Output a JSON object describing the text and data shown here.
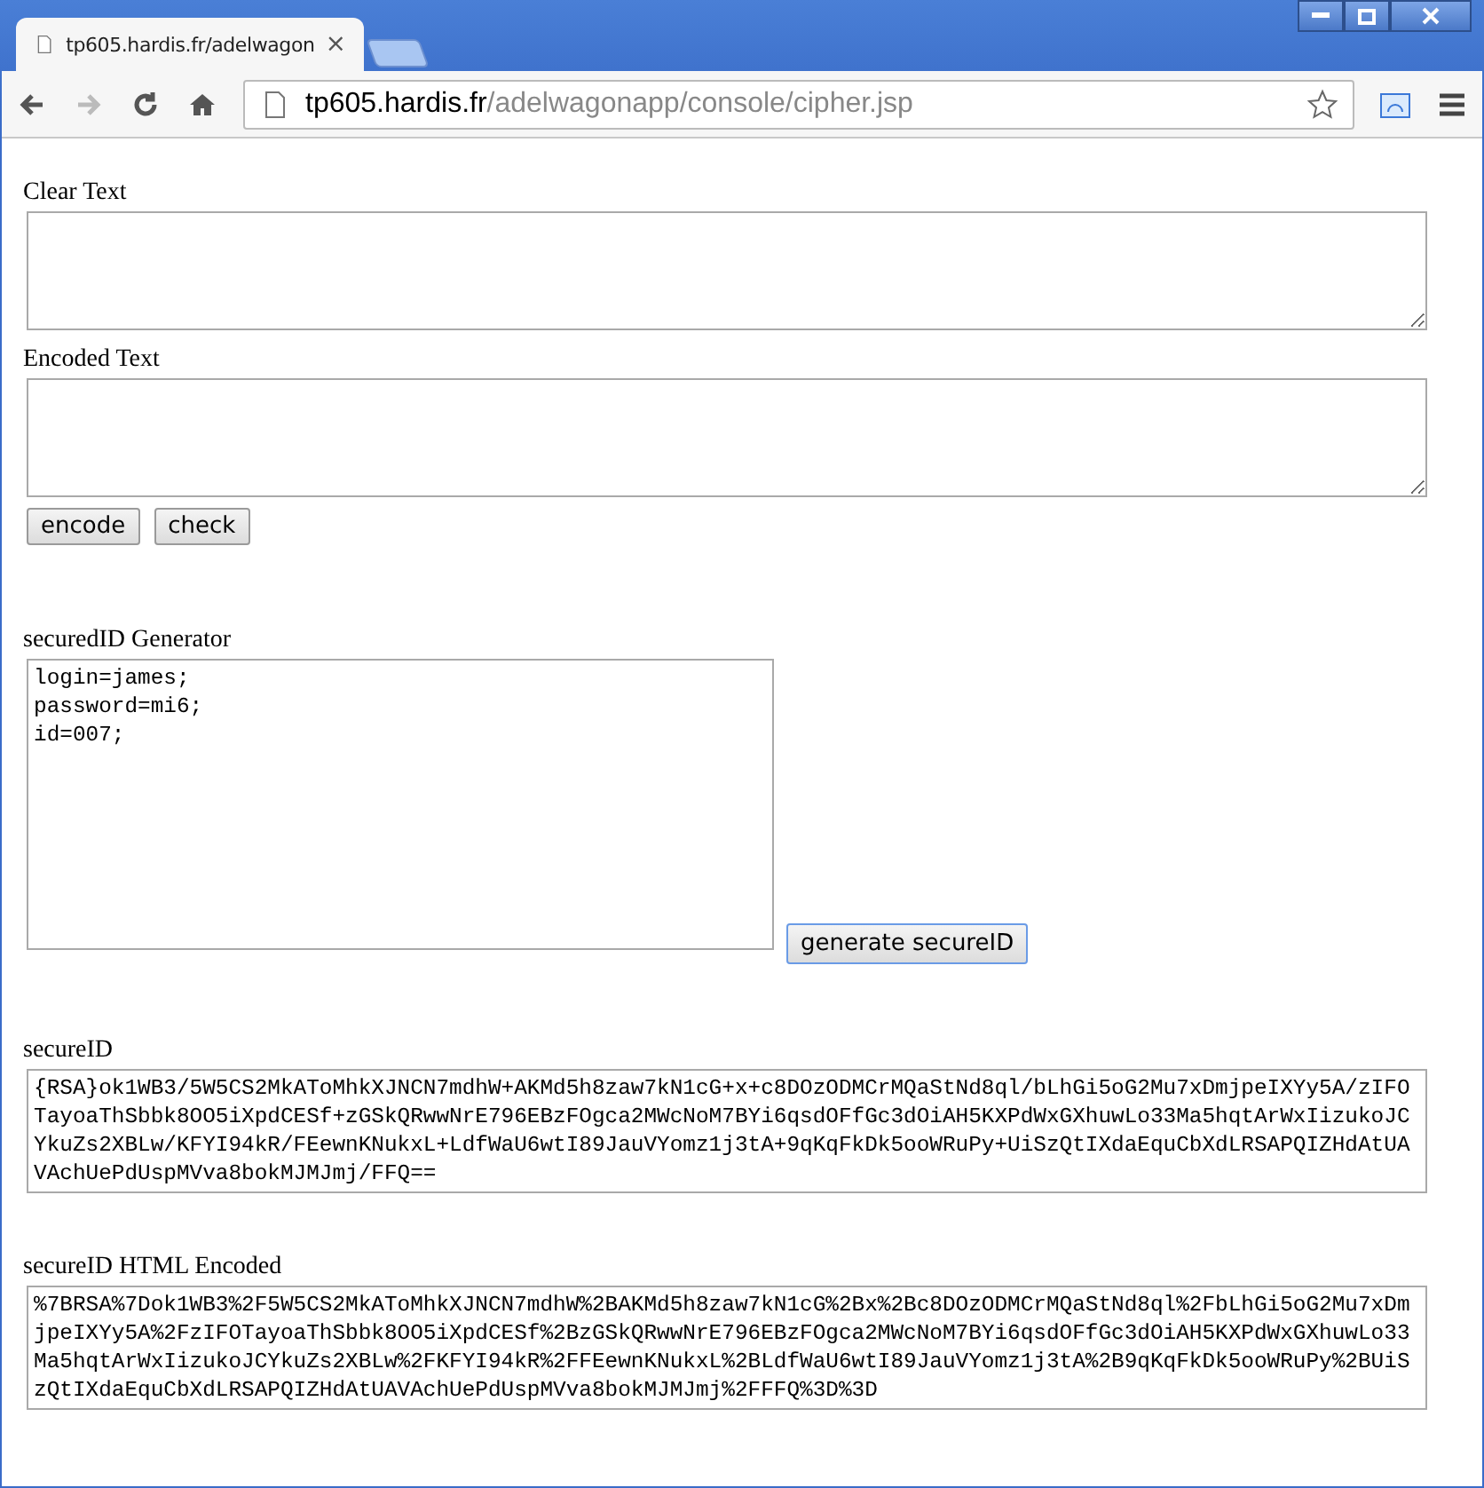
{
  "window": {
    "tab_title": "tp605.hardis.fr/adelwagon",
    "tab_close": "×"
  },
  "address_bar": {
    "host": "tp605.hardis.fr",
    "path": "/adelwagonapp/console/cipher.jsp"
  },
  "cipher": {
    "clear_label": "Clear Text",
    "encoded_label": "Encoded Text",
    "buttons": [
      "encode",
      "check"
    ]
  },
  "generator": {
    "label": "securedID Generator",
    "lines": [
      "login=james;",
      "password=mi6;",
      "id=007;"
    ],
    "button": "generate secureID"
  },
  "secure_id": {
    "label": "secureID",
    "value": "{RSA}ok1WB3/5W5CS2MkAToMhkXJNCN7mdhW+AKMd5h8zaw7kN1cG+x+c8DOzODMCrMQaStNd8ql/bLhGi5oG2Mu7xDmjpeIXYy5A/zIFOTayoaThSbbk8OO5iXpdCESf+zGSkQRwwNrE796EBzFOgca2MWcNoM7BYi6qsdOFfGc3dOiAH5KXPdWxGXhuwLo33Ma5hqtArWxIizukoJCYkuZs2XBLw/KFYI94kR/FEewnKNukxL+LdfWaU6wtI89JauVYomz1j3tA+9qKqFkDk5ooWRuPy+UiSzQtIXdaEquCbXdLRSAPQIZHdAtUAVAchUePdUspMVva8bokMJMJmj/FFQ=="
  },
  "secure_id_html": {
    "label": "secureID HTML Encoded",
    "value": "%7BRSA%7Dok1WB3%2F5W5CS2MkAToMhkXJNCN7mdhW%2BAKMd5h8zaw7kN1cG%2Bx%2Bc8DOzODMCrMQaStNd8ql%2FbLhGi5oG2Mu7xDmjpeIXYy5A%2FzIFOTayoaThSbbk8OO5iXpdCESf%2BzGSkQRwwNrE796EBzFOgca2MWcNoM7BYi6qsdOFfGc3dOiAH5KXPdWxGXhuwLo33Ma5hqtArWxIizukoJCYkuZs2XBLw%2FKFYI94kR%2FFEewnKNukxL%2BLdfWaU6wtI89JauVYomz1j3tA%2B9qKqFkDk5ooWRuPy%2BUiSzQtIXdaEquCbXdLRSAPQIZHdAtUAVAchUePdUspMVva8bokMJMJmj%2FFFQ%3D%3D"
  }
}
